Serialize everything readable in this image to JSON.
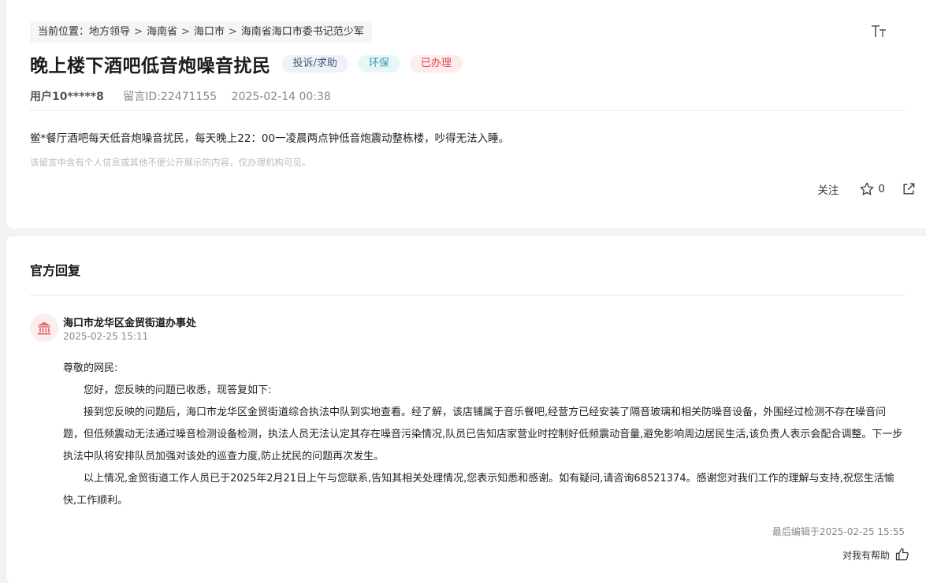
{
  "breadcrumb": {
    "prefix": "当前位置：",
    "items": [
      "地方领导",
      "海南省",
      "海口市",
      "海南省海口市委书记范少军"
    ],
    "sep": ">"
  },
  "post": {
    "title": "晚上楼下酒吧低音炮噪音扰民",
    "tags": {
      "type": "投诉/求助",
      "field": "环保",
      "status": "已办理"
    },
    "user": "用户10*****8",
    "message_id": "留言ID:22471155",
    "time": "2025-02-14 00:38",
    "content": "鲎*餐厅酒吧每天低音炮噪音扰民，每天晚上22：00一凌晨两点钟低音炮震动整栋楼，吵得无法入睡。",
    "privacy_notice": "该留言中含有个人信息或其他不便公开展示的内容，仅办理机构可见。"
  },
  "actions": {
    "follow_label": "关注",
    "star_count": "0"
  },
  "reply": {
    "section_title": "官方回复",
    "org_name": "海口市龙华区金贸街道办事处",
    "org_time": "2025-02-25 15:11",
    "greeting": "尊敬的网民:",
    "paragraphs": [
      "您好，您反映的问题已收悉，现答复如下:",
      "接到您反映的问题后，海口市龙华区金贸街道综合执法中队到实地查看。经了解，该店铺属于音乐餐吧,经营方已经安装了隔音玻璃和相关防噪音设备，外围经过检测不存在噪音问题，但低频震动无法通过噪音检测设备检测，执法人员无法认定其存在噪音污染情况,队员已告知店家营业时控制好低频震动音量,避免影响周边居民生活,该负责人表示会配合调整。下一步执法中队将安排队员加强对该处的巡查力度,防止扰民的问题再次发生。",
      "以上情况,金贸街道工作人员已于2025年2月21日上午与您联系,告知其相关处理情况,您表示知悉和感谢。如有疑问,请咨询68521374。感谢您对我们工作的理解与支持,祝您生活愉快,工作顺利。"
    ],
    "last_edit": "最后编辑于2025-02-25 15:55",
    "helpful_label": "对我有帮助"
  },
  "icons": {
    "font_size": "font-size-icon",
    "star": "star-icon",
    "share": "share-icon",
    "org": "government-building-icon",
    "thumbs_up": "thumbs-up-icon"
  },
  "colors": {
    "tag_type_text": "#4b5a7a",
    "tag_field_text": "#2a9aa8",
    "tag_status_text": "#e0454f",
    "org_icon": "#e46a6a"
  }
}
